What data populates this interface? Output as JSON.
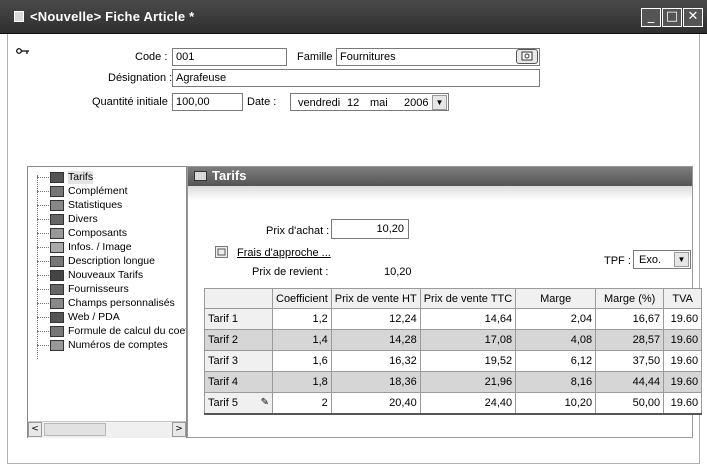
{
  "window": {
    "title": "<Nouvelle> Fiche Article *",
    "minimize_label": "_",
    "maximize_label": "□",
    "close_label": "✕"
  },
  "form": {
    "code_label": "Code :",
    "code_value": "001",
    "famille_label": "Famille :",
    "famille_value": "Fournitures",
    "designation_label": "Désignation :",
    "designation_value": "Agrafeuse",
    "quantite_label": "Quantité initiale :",
    "quantite_value": "100,00",
    "date_label": "Date :",
    "date_day": "vendredi",
    "date_num": "12",
    "date_month": "mai",
    "date_year": "2006"
  },
  "tree": {
    "items": [
      {
        "label": "Tarifs",
        "icon": "tarifs-icon"
      },
      {
        "label": "Complément",
        "icon": "complement-icon"
      },
      {
        "label": "Statistiques",
        "icon": "statistics-icon"
      },
      {
        "label": "Divers",
        "icon": "divers-icon"
      },
      {
        "label": "Composants",
        "icon": "components-icon"
      },
      {
        "label": "Infos. / Image",
        "icon": "image-icon"
      },
      {
        "label": "Description longue",
        "icon": "description-icon"
      },
      {
        "label": "Nouveaux Tarifs",
        "icon": "new-tariffs-icon"
      },
      {
        "label": "Fournisseurs",
        "icon": "suppliers-icon"
      },
      {
        "label": "Champs personnalisés",
        "icon": "custom-fields-icon"
      },
      {
        "label": "Web / PDA",
        "icon": "web-icon"
      },
      {
        "label": "Formule de calcul du coef",
        "icon": "formula-icon"
      },
      {
        "label": "Numéros de comptes",
        "icon": "accounts-icon"
      }
    ],
    "scroll_left": "<",
    "scroll_right": ">"
  },
  "panel": {
    "title": "Tarifs",
    "prix_achat_label": "Prix d'achat :",
    "prix_achat_value": "10,20",
    "frais_label": "Frais d'approche ...",
    "prix_revient_label": "Prix de revient :",
    "prix_revient_value": "10,20",
    "tpf_label": "TPF :",
    "tpf_value": "Exo."
  },
  "grid": {
    "columns": [
      "",
      "Coefficient",
      "Prix de vente HT",
      "Prix de vente TTC",
      "Marge",
      "Marge (%)",
      "TVA"
    ],
    "rows": [
      [
        "Tarif 1",
        "1,2",
        "12,24",
        "14,64",
        "2,04",
        "16,67",
        "19.60"
      ],
      [
        "Tarif 2",
        "1,4",
        "14,28",
        "17,08",
        "4,08",
        "28,57",
        "19.60"
      ],
      [
        "Tarif 3",
        "1,6",
        "16,32",
        "19,52",
        "6,12",
        "37,50",
        "19.60"
      ],
      [
        "Tarif 4",
        "1,8",
        "18,36",
        "21,96",
        "8,16",
        "44,44",
        "19.60"
      ],
      [
        "Tarif 5",
        "2",
        "20,40",
        "24,40",
        "10,20",
        "50,00",
        "19.60"
      ]
    ]
  }
}
